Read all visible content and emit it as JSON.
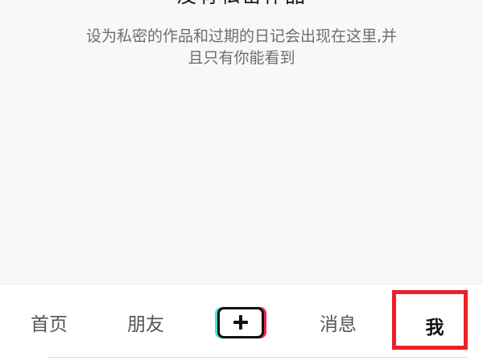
{
  "empty_state": {
    "title": "没有私密作品",
    "description_line1": "设为私密的作品和过期的日记会出现在这里,并",
    "description_line2": "且只有你能看到"
  },
  "tabbar": {
    "home": "首页",
    "friends": "朋友",
    "messages": "消息",
    "me": "我",
    "add_icon": "plus-icon"
  },
  "colors": {
    "highlight": "#ea2128",
    "accent_cyan": "#3fe2e2",
    "accent_red": "#f3234f"
  }
}
